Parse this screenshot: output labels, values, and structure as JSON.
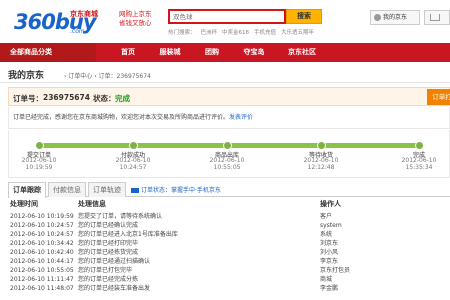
{
  "header": {
    "logo_text": "360buy",
    "logo_tag": "京东商城",
    "logo_sub": ".com",
    "slogan_line1": "网购上京东",
    "slogan_line2": "省钱又放心",
    "search_placeholder": "双色球",
    "search_button": "搜索",
    "hot_words_label": "热门搜索：",
    "hot_words": [
      "巴洲杯",
      "中奖金618",
      "手机充值",
      "大乐透五期年"
    ],
    "my_jd": "我的京东"
  },
  "nav": {
    "all_categories": "全部商品分类",
    "items": [
      "首页",
      "服装城",
      "团购",
      "夺宝岛",
      "京东社区"
    ]
  },
  "breadcrumb": {
    "title": "我的京东",
    "path": "› 订单中心 › 订单：236975674"
  },
  "order": {
    "number_label": "订单号：",
    "number": "236975674",
    "status_label": "状态：",
    "status": "完成",
    "button": "订单打",
    "notice": "订单已经完成，感谢您在京东商城购物，欢迎您对本次交易及所购商品进行评价。",
    "notice_link": "发表评价"
  },
  "progress": {
    "steps": [
      {
        "label": "提交订单",
        "date": "2012-06-10",
        "time": "10:19:59"
      },
      {
        "label": "付款成功",
        "date": "2012-06-10",
        "time": "10:24:57"
      },
      {
        "label": "商品出库",
        "date": "2012-06-10",
        "time": "10:55:05"
      },
      {
        "label": "等待收货",
        "date": "2012-06-10",
        "time": "12:12:48"
      },
      {
        "label": "完成",
        "date": "2012-06-10",
        "time": "15:35:34"
      }
    ],
    "accent": "#7cb342"
  },
  "tabs": {
    "items": [
      "订单跟踪",
      "付款信息",
      "订单轨迹"
    ],
    "links": "订单状态：掌握手中·手机京东"
  },
  "table": {
    "headers": [
      "处理时间",
      "处理信息",
      "操作人"
    ],
    "rows": [
      [
        "2012-06-10 10:19:59",
        "您提交了订单，请等待系统确认",
        "客户"
      ],
      [
        "2012-06-10 10:24:57",
        "您的订单已经确认完成",
        "system"
      ],
      [
        "2012-06-10 10:24:57",
        "您的订单已经进入北京1号库准备出库",
        "系统"
      ],
      [
        "2012-06-10 10:34:42",
        "您的订单已经打印完毕",
        "刘京东"
      ],
      [
        "2012-06-10 10:42:40",
        "您的订单已经拣货完成",
        "刘小风"
      ],
      [
        "2012-06-10 10:44:17",
        "您的订单已经通过扫描确认",
        "李京东"
      ],
      [
        "2012-06-10 10:55:05",
        "您的订单已打包完毕",
        "京东打包员"
      ],
      [
        "2012-06-10 11:11:47",
        "您的订单已经完成分拣",
        "商城"
      ],
      [
        "2012-06-10 11:48:07",
        "您的订单已经装车准备出发",
        "李金鹏"
      ]
    ]
  },
  "colors": {
    "brand_red": "#c81623",
    "brand_blue": "#1a64c9",
    "status_green": "#1f9d1f",
    "search_orange": "#ffb300"
  }
}
